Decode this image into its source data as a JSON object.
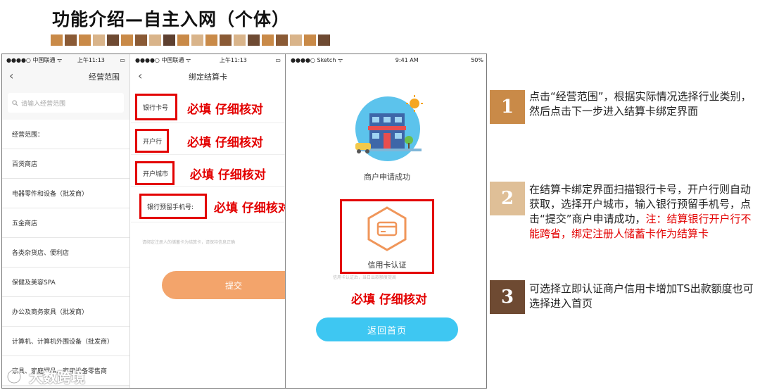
{
  "slide": {
    "title": "功能介绍—自主入网（个体）",
    "swatch_colors": [
      "#c98a48",
      "#8a5a35",
      "#c98a48",
      "#d9b48a",
      "#6e4a32",
      "#c98a48",
      "#8a5a35",
      "#d9b48a",
      "#5e4030",
      "#c98a48",
      "#d9b48a",
      "#c98a48",
      "#8a5a35",
      "#d9b48a",
      "#6e4a32",
      "#c98a48",
      "#8a5a35",
      "#d9b48a",
      "#c98a48",
      "#6e4a32"
    ]
  },
  "phone1": {
    "status": {
      "carrier": "●●●●○ 中国联通 ᯤ",
      "time": "上午11:13",
      "battery": "▭"
    },
    "nav_title": "经营范围",
    "back_icon": "‹",
    "search_placeholder": "请输入经营范围",
    "list_header": "经营范围：",
    "items": [
      "百货商店",
      "电器零件和设备（批发商）",
      "五金商店",
      "各类杂货店、便利店",
      "保健及美容SPA",
      "办公及商务家具（批发商）",
      "计算机、计算机外围设备（批发商）",
      "家具、家庭摆品、家用设备零售商"
    ]
  },
  "phone2": {
    "status": {
      "carrier": "●●●●○ 中国联通 ᯤ",
      "time": "上午11:13",
      "battery": "▭"
    },
    "nav_title": "绑定结算卡",
    "back_icon": "‹",
    "fields": [
      {
        "label": "银行卡号",
        "note": "必填 仔细核对"
      },
      {
        "label": "开户行",
        "note": "必填 仔细核对"
      },
      {
        "label": "开户城市",
        "note": "必填 仔细核对"
      },
      {
        "label": "银行预留手机号:",
        "note": "必填 仔细核对"
      }
    ],
    "hint": "请绑定注册人的储蓄卡为结算卡，请保持信息正确",
    "submit_label": "提交"
  },
  "phone3": {
    "status": {
      "carrier": "●●●●○ Sketch ᯤ",
      "time": "9:41 AM",
      "battery": "50%"
    },
    "success_text": "商户申请成功",
    "card_label": "信用卡认证",
    "faint_text": "信用卡认证后，当日出款额度提高",
    "note": "必填 仔细核对",
    "home_label": "返回首页"
  },
  "steps": [
    {
      "number": "1",
      "color": "#c98a48",
      "text": "点击“经营范围”，根据实际情况选择行业类别，然后点击下一步进入结算卡绑定界面",
      "red": ""
    },
    {
      "number": "2",
      "color": "#dfbf97",
      "text": "在结算卡绑定界面扫描银行卡号，开户行则自动获取，选择开户城市，输入银行预留手机号，点击“提交”商户申请成功，",
      "red": "注：结算银行开户行不能跨省，绑定注册人储蓄卡作为结算卡"
    },
    {
      "number": "3",
      "color": "#6e4a32",
      "text": "可选择立即认证商户信用卡增加TS出款额度也可选择进入首页",
      "red": ""
    }
  ],
  "watermark": "大数跨境"
}
